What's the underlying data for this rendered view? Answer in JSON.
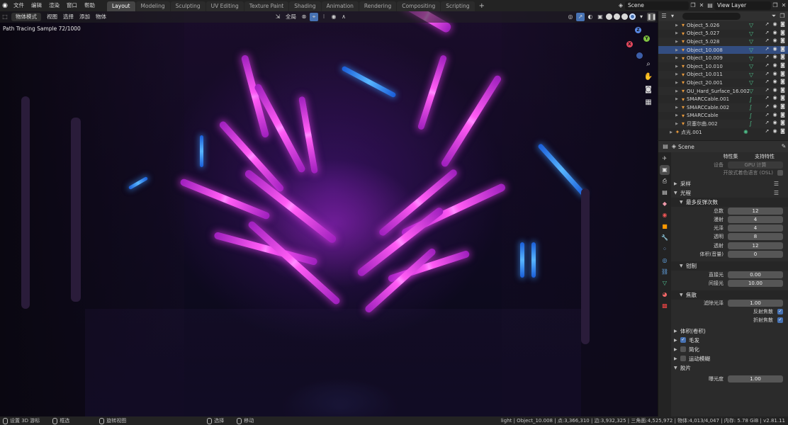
{
  "topbar": {
    "menus": [
      "文件",
      "编辑",
      "渲染",
      "窗口",
      "帮助"
    ],
    "tabs": [
      "Layout",
      "Modeling",
      "Sculpting",
      "UV Editing",
      "Texture Paint",
      "Shading",
      "Animation",
      "Rendering",
      "Compositing",
      "Scripting"
    ],
    "active_tab": "Layout",
    "add_tab": "+",
    "scene": "Scene",
    "view_layer": "View Layer"
  },
  "viewport": {
    "mode": "物体模式",
    "menus": [
      "视图",
      "选择",
      "添加",
      "物体"
    ],
    "transform_orientation": "全局",
    "sample_text": "Path Tracing Sample 72/1000",
    "gizmo_axes": {
      "z": "Z",
      "y": "Y",
      "x": "X"
    }
  },
  "outliner": {
    "search_placeholder": "",
    "rows": [
      {
        "name": "Object_5.026",
        "type": "mesh",
        "selected": false
      },
      {
        "name": "Object_5.027",
        "type": "mesh",
        "selected": false
      },
      {
        "name": "Object_5.028",
        "type": "mesh",
        "selected": false
      },
      {
        "name": "Object_10.008",
        "type": "mesh",
        "selected": true
      },
      {
        "name": "Object_10.009",
        "type": "mesh",
        "selected": false
      },
      {
        "name": "Object_10.010",
        "type": "mesh",
        "selected": false
      },
      {
        "name": "Object_10.011",
        "type": "mesh",
        "selected": false
      },
      {
        "name": "Object_20.001",
        "type": "mesh",
        "selected": false
      },
      {
        "name": "OU_Hard_Surface_16.002",
        "type": "mesh",
        "selected": false
      },
      {
        "name": "SMARCCable.001",
        "type": "curve",
        "selected": false
      },
      {
        "name": "SMARCCable.002",
        "type": "curve",
        "selected": false
      },
      {
        "name": "SMARCCable",
        "type": "curve",
        "selected": false
      },
      {
        "name": "贝塞尔曲.002",
        "type": "curve",
        "selected": false
      },
      {
        "name": "点光.001",
        "type": "light",
        "selected": false
      }
    ]
  },
  "properties": {
    "header": "Scene",
    "tabs_labels": {
      "left": "特性集",
      "right": "支持特性"
    },
    "device_label": "设备",
    "device_value": "GPU 计算",
    "osl_label": "开放式着色语言 (OSL)",
    "sections": {
      "sampling": "采样",
      "light_paths": "光程",
      "max_bounces": "最多反弹次数",
      "clamping": "钳制",
      "caustics": "焦散",
      "volumes": "体积(卷积)",
      "hair": "毛发",
      "simplify": "简化",
      "motion_blur": "运动模糊",
      "film": "胶片"
    },
    "bounces": [
      {
        "label": "总数",
        "value": "12"
      },
      {
        "label": "漫射",
        "value": "4"
      },
      {
        "label": "光泽",
        "value": "4"
      },
      {
        "label": "透明",
        "value": "8"
      },
      {
        "label": "透射",
        "value": "12"
      },
      {
        "label": "体积(音量)",
        "value": "0"
      }
    ],
    "clamping": [
      {
        "label": "直接光",
        "value": "0.00"
      },
      {
        "label": "间接光",
        "value": "10.00"
      }
    ],
    "caustics": {
      "filter_label": "滤除光泽",
      "filter_value": "1.00",
      "reflective_label": "反射焦散",
      "refractive_label": "折射焦散"
    },
    "film": {
      "exposure_label": "曝光度",
      "exposure_value": "1.00"
    }
  },
  "statusbar": {
    "left": [
      "设置 3D 游标",
      "框选",
      "旋转视图",
      "选择",
      "移动"
    ],
    "right": "light | Object_10.008 | 点:3,366,310 | 边:3,932,325 | 三角面:4,525,972 | 物体:4,013/4,047 | 内存: 5.78 GiB | v2.81.11"
  },
  "colors": {
    "accent": "#4772b3",
    "selected_row": "#334d80",
    "mesh_icon": "#e89a3c",
    "modifier_icon": "#4fc28b"
  }
}
